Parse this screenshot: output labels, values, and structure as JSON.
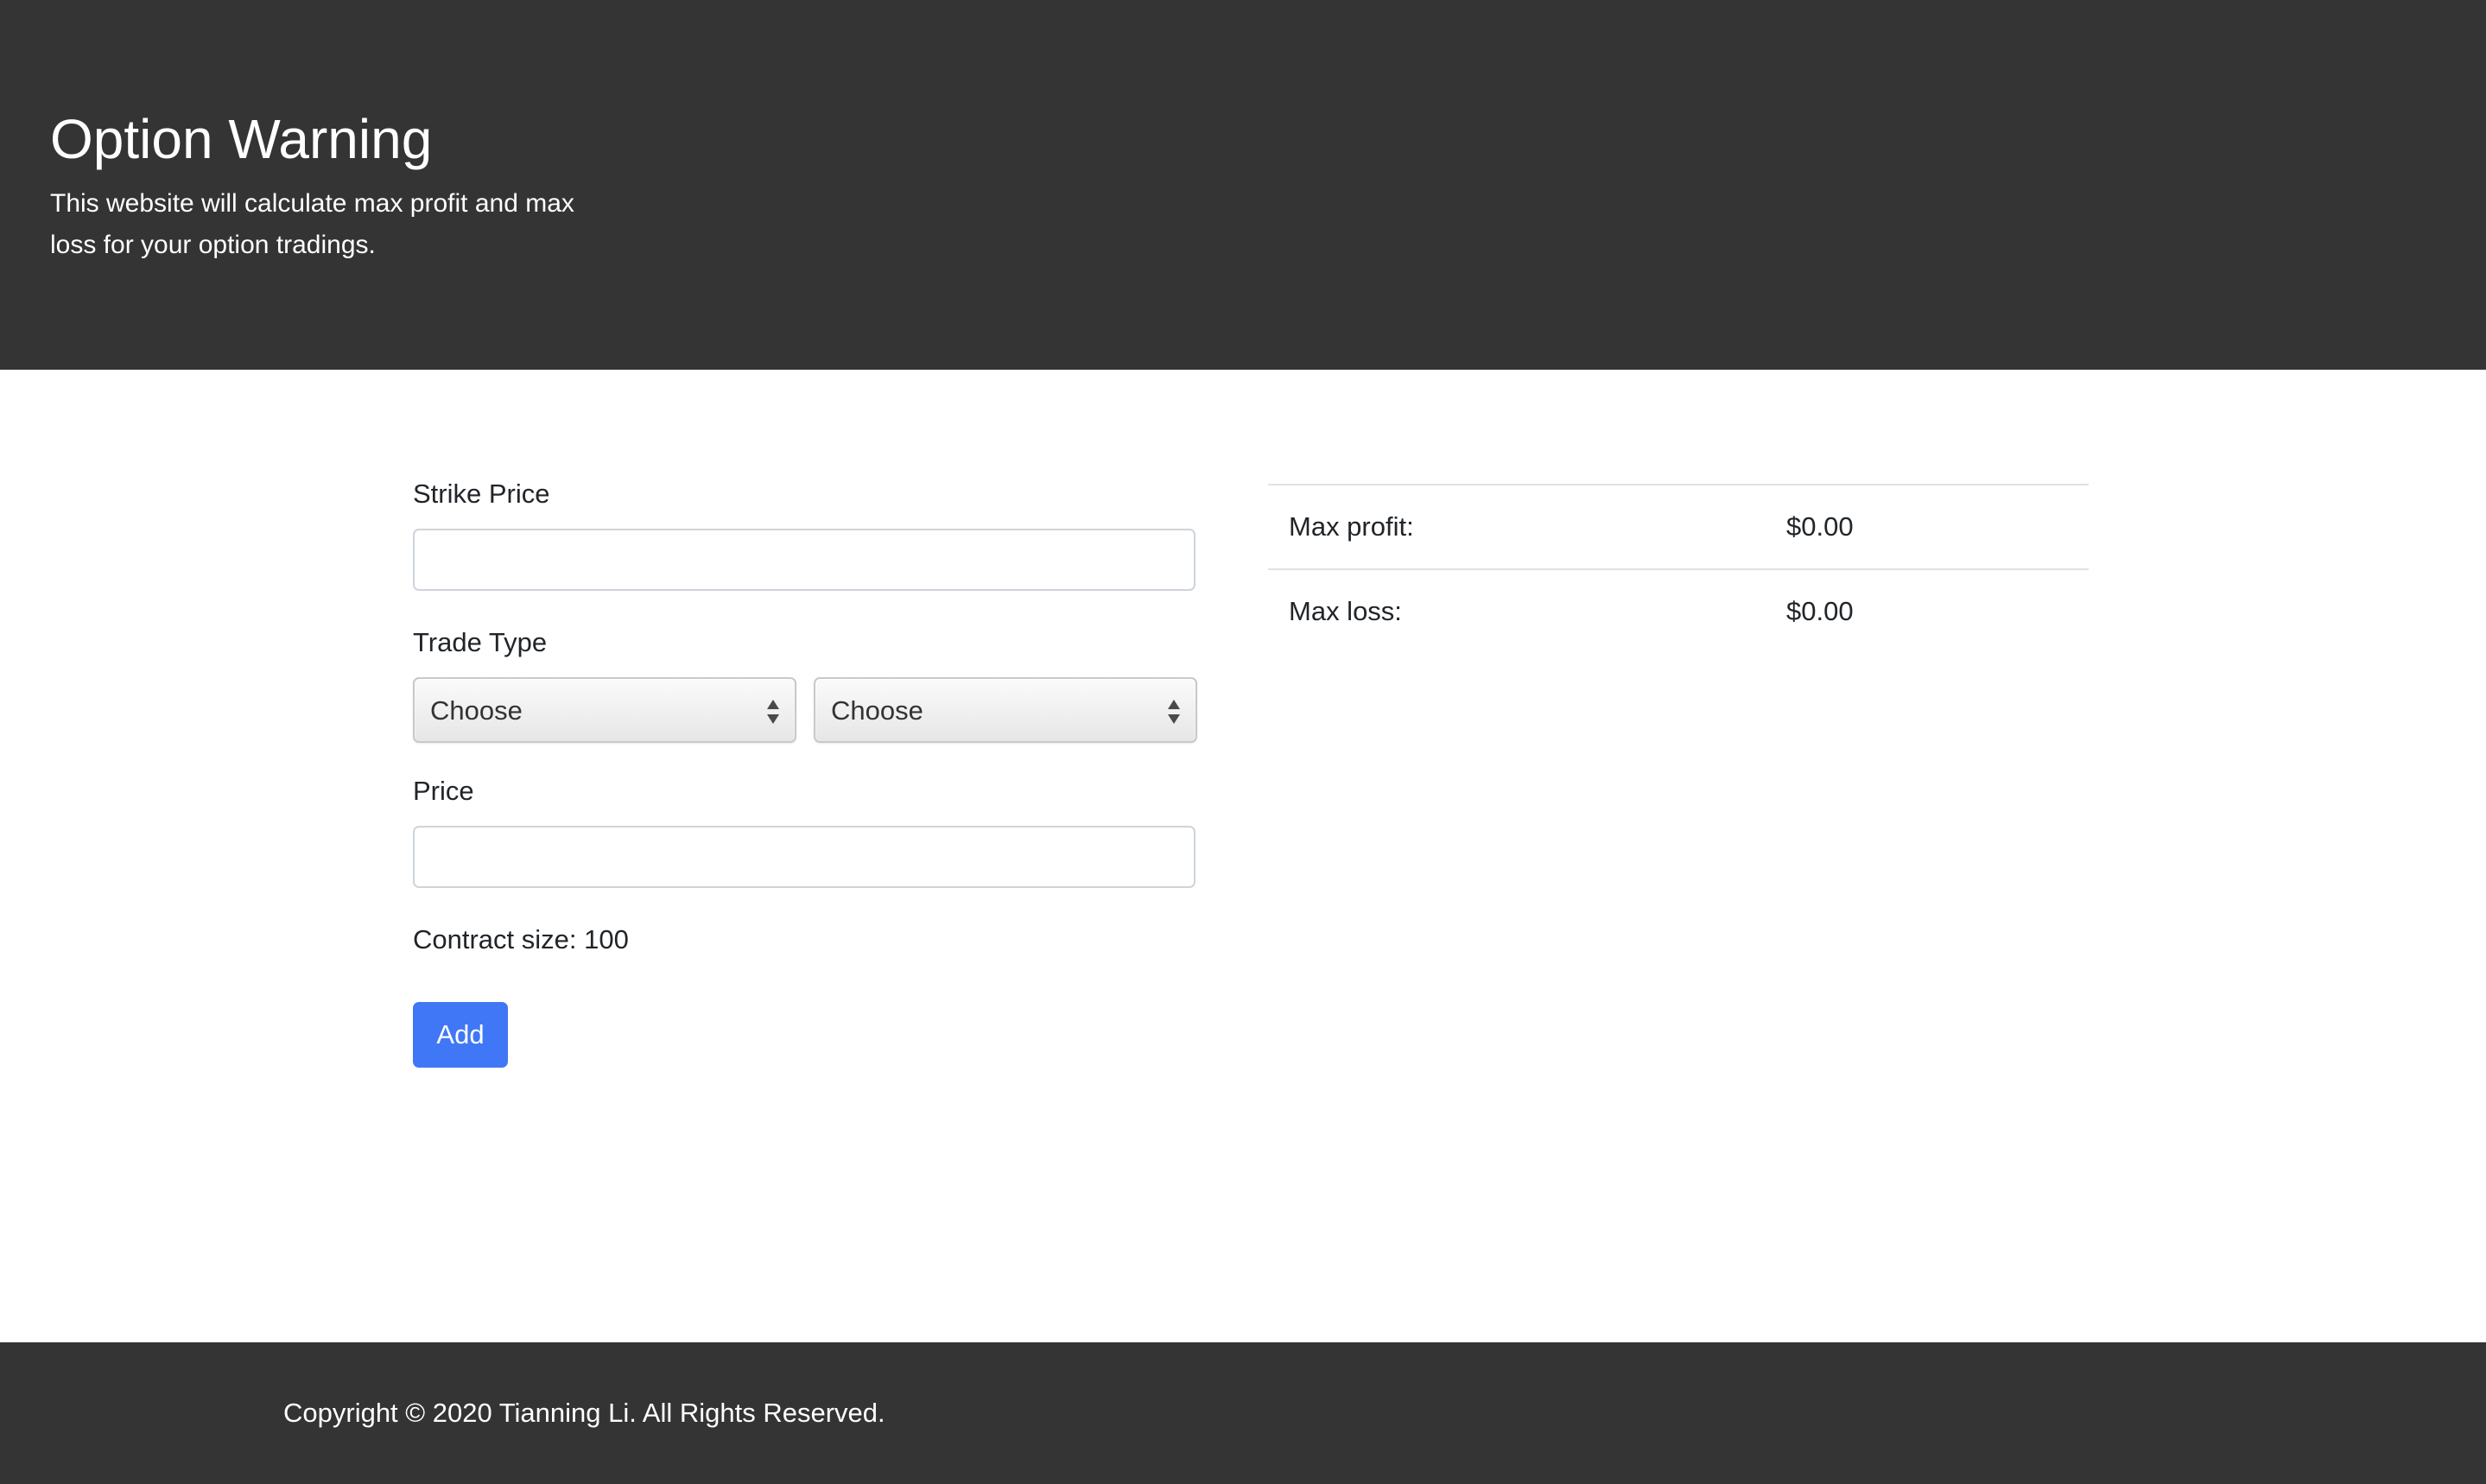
{
  "header": {
    "title": "Option Warning",
    "description": "This website will calculate max profit and max loss for your option tradings."
  },
  "form": {
    "strike_price_label": "Strike Price",
    "strike_price_value": "",
    "trade_type_label": "Trade Type",
    "trade_type_select_1": "Choose",
    "trade_type_select_2": "Choose",
    "price_label": "Price",
    "price_value": "",
    "contract_size_text": "Contract size: 100",
    "add_label": "Add"
  },
  "results": {
    "max_profit_label": "Max profit:",
    "max_profit_value": "$0.00",
    "max_loss_label": "Max loss:",
    "max_loss_value": "$0.00"
  },
  "footer": {
    "copyright": "Copyright © 2020 Tianning Li. All Rights Reserved."
  },
  "colors": {
    "header_bg": "#343434",
    "accent": "#4077f6"
  }
}
